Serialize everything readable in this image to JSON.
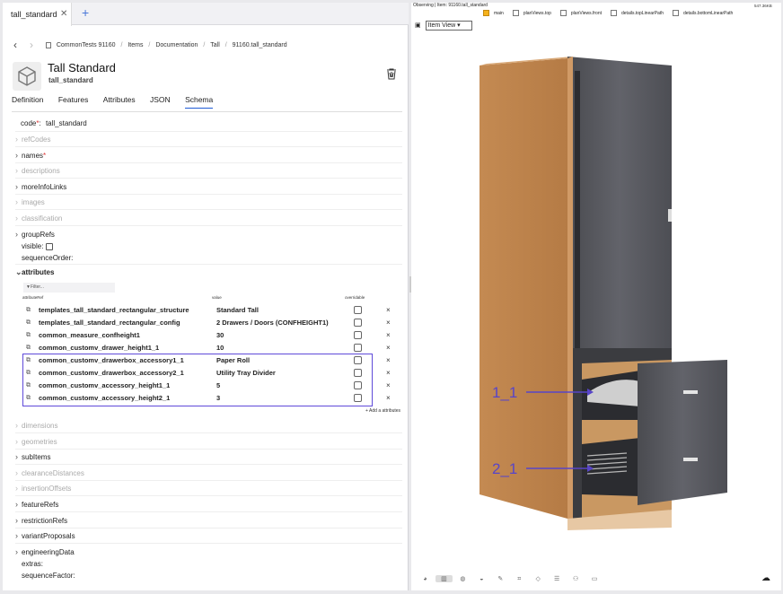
{
  "tab": {
    "title": "tall_standard",
    "close": "✕",
    "add": "+"
  },
  "breadcrumb": {
    "back": "‹",
    "forward": "›",
    "items": [
      "CommonTests 91160",
      "Items",
      "Documentation",
      "Tall",
      "91160.tall_standard"
    ],
    "separator": "/"
  },
  "header": {
    "title": "Tall Standard",
    "subtitle": "tall_standard"
  },
  "schema_tabs": [
    "Definition",
    "Features",
    "Attributes",
    "JSON",
    "Schema"
  ],
  "active_tab": "Schema",
  "properties": {
    "code_label": "code",
    "code_value": "tall_standard",
    "required_mark": "*",
    "refCodes": "refCodes",
    "names": "names",
    "descriptions": "descriptions",
    "moreInfoLinks": "moreInfoLinks",
    "images": "images",
    "classification": "classification",
    "groupRefs": "groupRefs",
    "visible": "visible:",
    "sequenceOrder": "sequenceOrder:",
    "attributes": "attributes",
    "dimensions": "dimensions",
    "geometries": "geometries",
    "subItems": "subItems",
    "clearanceDistances": "clearanceDistances",
    "insertionOffsets": "insertionOffsets",
    "featureRefs": "featureRefs",
    "restrictionRefs": "restrictionRefs",
    "variantProposals": "variantProposals",
    "engineeringData": "engineeringData",
    "extras": "extras:",
    "sequenceFactor": "sequenceFactor:"
  },
  "attributes_table": {
    "filter_placeholder": "Filter...",
    "columns": [
      "attributeRef",
      "value",
      "overridable"
    ],
    "rows": [
      {
        "ref": "templates_tall_standard_rectangular_structure",
        "value": "Standard Tall"
      },
      {
        "ref": "templates_tall_standard_rectangular_config",
        "value": "2 Drawers / Doors (CONFHEIGHT1)"
      },
      {
        "ref": "common_measure_confheight1",
        "value": "30"
      },
      {
        "ref": "common_customv_drawer_height1_1",
        "value": "10"
      },
      {
        "ref": "common_customv_drawerbox_accessory1_1",
        "value": "Paper Roll"
      },
      {
        "ref": "common_customv_drawerbox_accessory2_1",
        "value": "Utility Tray Divider"
      },
      {
        "ref": "common_customv_accessory_height1_1",
        "value": "5"
      },
      {
        "ref": "common_customv_accessory_height2_1",
        "value": "3"
      }
    ],
    "remove": "×",
    "add_label": "+ Add a attributes"
  },
  "viewer": {
    "observing": "Observing | Item: 91160.tall_standard",
    "size": "547.36KB",
    "layers": [
      {
        "label": "main",
        "checked": true
      },
      {
        "label": "planViews.top",
        "checked": false
      },
      {
        "label": "planViews.front",
        "checked": false
      },
      {
        "label": "details.topLinearPath",
        "checked": false
      },
      {
        "label": "details.bottomLinearPath",
        "checked": false
      }
    ],
    "view_select": "Item View",
    "annotations": [
      "1_1",
      "2_1"
    ],
    "colors": {
      "carcass": "#c88f56",
      "door": "#55565c",
      "annotation": "#5845c8"
    }
  },
  "toolbar_icons": [
    "palette-icon",
    "box-icon",
    "cube-icon",
    "layers-icon",
    "brush-icon",
    "measure-icon",
    "node-icon",
    "grid-icon",
    "robot-icon",
    "camera-icon"
  ]
}
